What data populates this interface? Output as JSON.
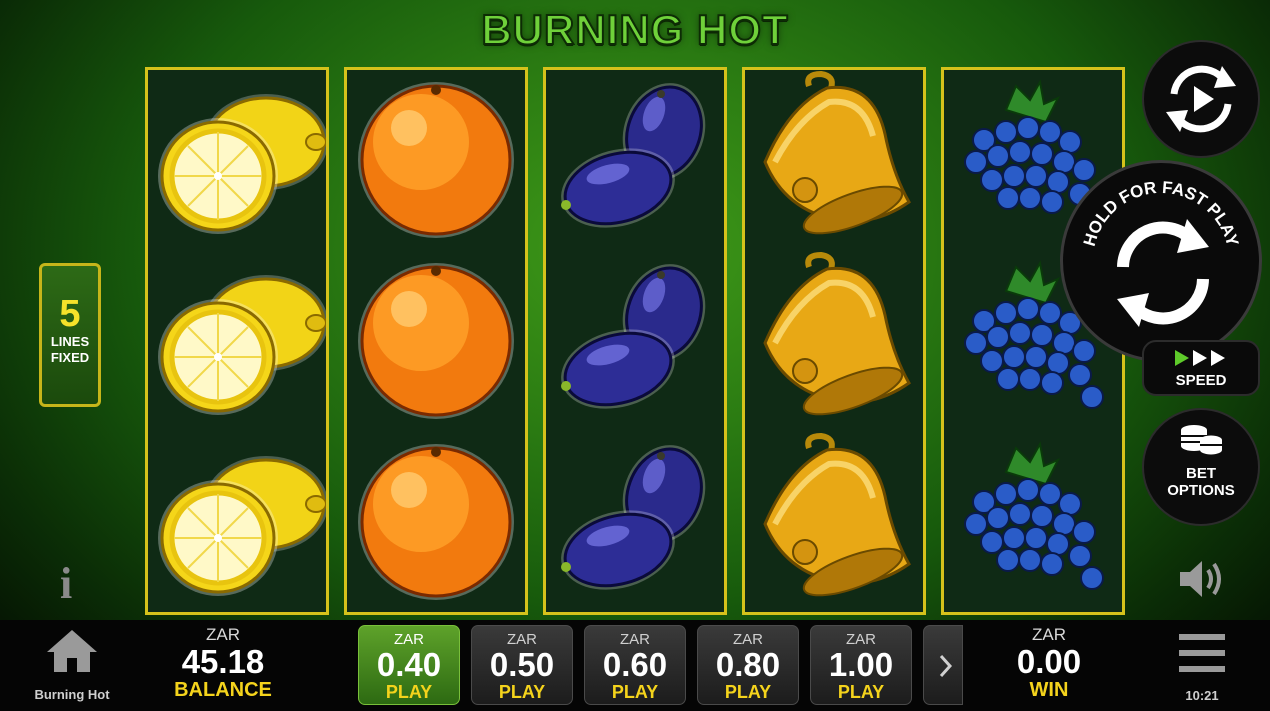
{
  "game": {
    "title": "BURNING HOT"
  },
  "reels": [
    [
      "lemon",
      "lemon",
      "lemon"
    ],
    [
      "orange",
      "orange",
      "orange"
    ],
    [
      "plum",
      "plum",
      "plum"
    ],
    [
      "bell",
      "bell",
      "bell"
    ],
    [
      "grapes",
      "grapes",
      "grapes"
    ]
  ],
  "lines": {
    "count": "5",
    "line1": "LINES",
    "line2": "FIXED"
  },
  "controls": {
    "autoplay_icon": "autoplay-icon",
    "spin_hint": "HOLD FOR FAST PLAY",
    "spin_icon": "spin-icon",
    "speed_label": "SPEED",
    "bet_options_line1": "BET",
    "bet_options_line2": "OPTIONS"
  },
  "balance": {
    "currency": "ZAR",
    "value": "45.18",
    "label": "BALANCE"
  },
  "bets": [
    {
      "currency": "ZAR",
      "value": "0.40",
      "label": "PLAY",
      "selected": true
    },
    {
      "currency": "ZAR",
      "value": "0.50",
      "label": "PLAY",
      "selected": false
    },
    {
      "currency": "ZAR",
      "value": "0.60",
      "label": "PLAY",
      "selected": false
    },
    {
      "currency": "ZAR",
      "value": "0.80",
      "label": "PLAY",
      "selected": false
    },
    {
      "currency": "ZAR",
      "value": "1.00",
      "label": "PLAY",
      "selected": false
    }
  ],
  "win": {
    "currency": "ZAR",
    "value": "0.00",
    "label": "WIN"
  },
  "home": {
    "label": "Burning Hot"
  },
  "clock": "10:21",
  "colors": {
    "accent_green": "#5ea22a",
    "gold": "#f4d31c",
    "reel_border": "#d5c21b"
  }
}
